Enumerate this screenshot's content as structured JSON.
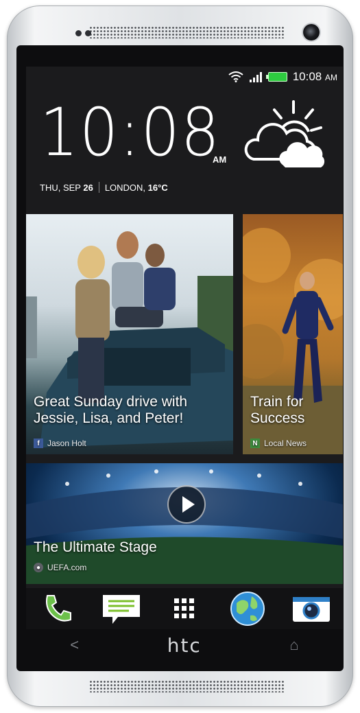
{
  "status_bar": {
    "time": "10:08",
    "ampm": "AM"
  },
  "clock": {
    "time": "10:08",
    "ampm": "AM",
    "day": "THU, SEP",
    "date": "26",
    "location": "LONDON,",
    "temperature": "16°C"
  },
  "weather": {
    "icon": "partly-cloudy-icon"
  },
  "feed": [
    {
      "caption": "Great Sunday drive with Jessie, Lisa, and Peter!",
      "source": "Jason Holt",
      "source_icon": "facebook-icon"
    },
    {
      "caption": "Train for Success",
      "source": "Local News",
      "source_icon": "news-icon"
    },
    {
      "caption": "The Ultimate Stage",
      "source": "UEFA.com",
      "source_icon": "uefa-icon"
    }
  ],
  "dock": [
    {
      "icon": "phone-icon"
    },
    {
      "icon": "messages-icon"
    },
    {
      "icon": "app-grid-icon"
    },
    {
      "icon": "globe-icon"
    },
    {
      "icon": "camera-icon"
    }
  ],
  "nav": {
    "back": "<",
    "logo": "htc",
    "home": "⌂"
  },
  "colors": {
    "accent_green": "#2ecc40",
    "phone_green": "#6cc04a",
    "globe_blue": "#2f8fd6",
    "facebook_blue": "#3b5998"
  }
}
